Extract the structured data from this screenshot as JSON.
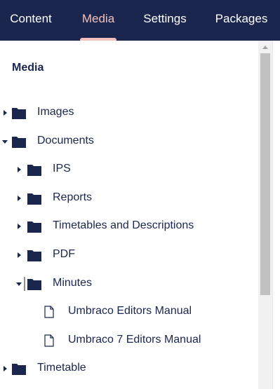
{
  "tabs": [
    {
      "label": "Content",
      "active": false
    },
    {
      "label": "Media",
      "active": true
    },
    {
      "label": "Settings",
      "active": false
    },
    {
      "label": "Packages",
      "active": false
    }
  ],
  "tree": {
    "title": "Media",
    "nodes": [
      {
        "label": "Images",
        "type": "folder",
        "expanded": false
      },
      {
        "label": "Documents",
        "type": "folder",
        "expanded": true
      },
      {
        "label": "IPS",
        "type": "folder",
        "expanded": false
      },
      {
        "label": "Reports",
        "type": "folder",
        "expanded": false
      },
      {
        "label": "Timetables and Descriptions",
        "type": "folder",
        "expanded": false
      },
      {
        "label": "PDF",
        "type": "folder",
        "expanded": false
      },
      {
        "label": "Minutes",
        "type": "folder",
        "expanded": true
      },
      {
        "label": "Umbraco Editors Manual",
        "type": "file"
      },
      {
        "label": "Umbraco 7 Editors Manual",
        "type": "file"
      },
      {
        "label": "Timetable",
        "type": "folder",
        "expanded": false
      }
    ]
  },
  "icons": {
    "folder": "folder-icon",
    "file": "document-icon",
    "collapsed": "caret-right-icon",
    "expanded": "caret-down-icon"
  },
  "colors": {
    "nav_background": "#1b264f",
    "nav_text": "#ffffff",
    "active_tab": "#f5c1bc",
    "tree_text": "#1b264f"
  }
}
